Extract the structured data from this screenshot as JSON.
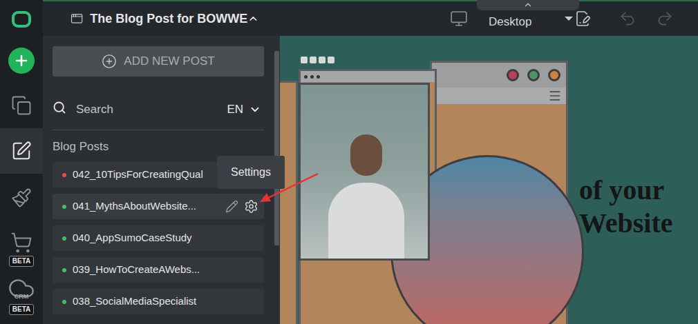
{
  "editor": {
    "title": "The Blog Post for BOWWE",
    "device": "Desktop",
    "undo_enabled": false,
    "redo_enabled": false
  },
  "rail": [
    {
      "kind": "logo",
      "selected": false
    },
    {
      "kind": "add",
      "selected": false
    },
    {
      "kind": "pages",
      "selected": false
    },
    {
      "kind": "blog",
      "selected": true
    },
    {
      "kind": "design",
      "selected": false
    },
    {
      "kind": "shop",
      "selected": false,
      "badge": "BETA"
    },
    {
      "kind": "crm",
      "selected": false,
      "label": "CRM",
      "badge": "BETA"
    }
  ],
  "panel": {
    "add_button": "ADD NEW POST",
    "search": {
      "placeholder": "Search"
    },
    "language": "EN",
    "section": "Blog Posts",
    "posts": [
      {
        "label": "042_10TipsForCreatingQual",
        "color": "#e0524a",
        "hovered": false
      },
      {
        "label": "041_MythsAboutWebsite...",
        "color": "#3fbf6a",
        "hovered": true
      },
      {
        "label": "040_AppSumoCaseStudy",
        "color": "#3fbf6a",
        "hovered": false
      },
      {
        "label": "039_HowToCreateAWebs...",
        "color": "#3fbf6a",
        "hovered": false
      },
      {
        "label": "038_SocialMediaSpecialist",
        "color": "#3fbf6a",
        "hovered": false
      }
    ]
  },
  "tooltip": {
    "text": "Settings"
  },
  "canvas": {
    "heading": [
      "of your",
      "Website"
    ]
  }
}
